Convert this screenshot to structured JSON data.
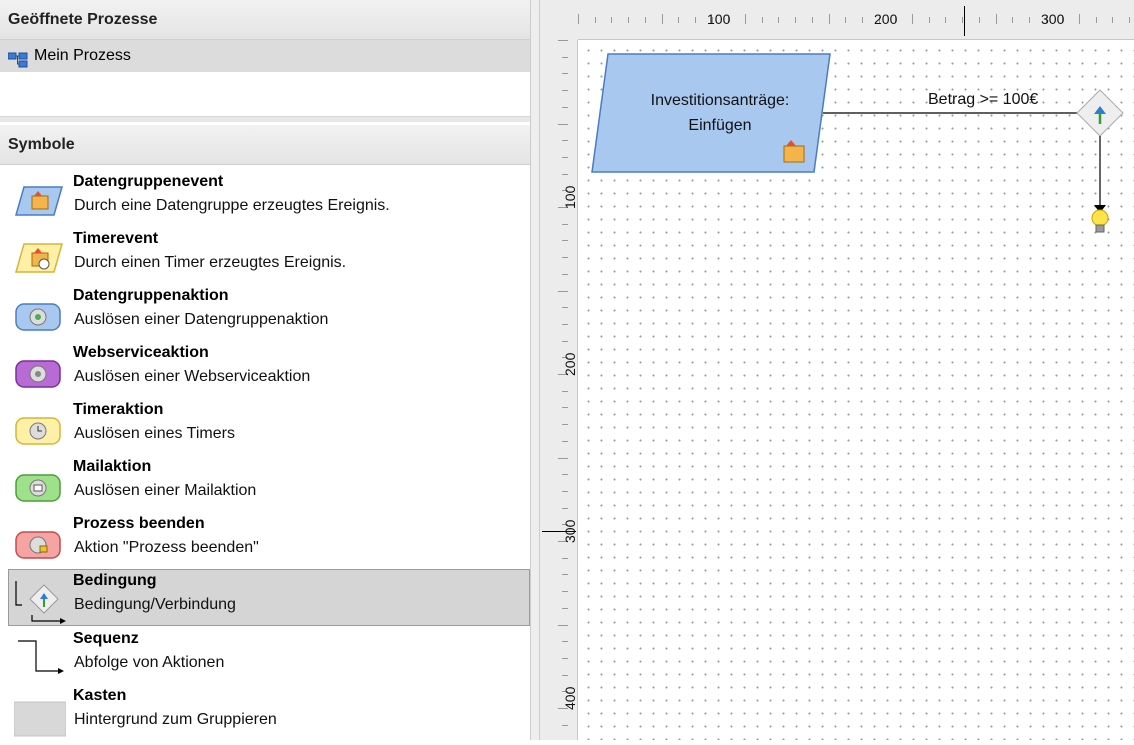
{
  "opened_processes": {
    "header": "Geöffnete Prozesse",
    "items": [
      {
        "label": "Mein Prozess",
        "icon": "process-tree-icon"
      }
    ]
  },
  "symbols": {
    "header": "Symbole",
    "items": [
      {
        "title": "Datengruppenevent",
        "desc": "Durch eine Datengruppe erzeugtes Ereignis.",
        "icon": "datagroup-event-icon"
      },
      {
        "title": "Timerevent",
        "desc": "Durch einen Timer erzeugtes Ereignis.",
        "icon": "timer-event-icon"
      },
      {
        "title": "Datengruppenaktion",
        "desc": "Auslösen einer Datengruppenaktion",
        "icon": "datagroup-action-icon",
        "color": "#a9c8f0"
      },
      {
        "title": "Webserviceaktion",
        "desc": "Auslösen einer Webserviceaktion",
        "icon": "webservice-action-icon",
        "color": "#b86bd4"
      },
      {
        "title": "Timeraktion",
        "desc": "Auslösen eines Timers",
        "icon": "timer-action-icon",
        "color": "#fff0a8"
      },
      {
        "title": "Mailaktion",
        "desc": "Auslösen einer Mailaktion",
        "icon": "mail-action-icon",
        "color": "#9fe08a"
      },
      {
        "title": "Prozess beenden",
        "desc": "Aktion \"Prozess beenden\"",
        "icon": "end-process-icon",
        "color": "#f5a3a3"
      },
      {
        "title": "Bedingung",
        "desc": "Bedingung/Verbindung",
        "icon": "condition-icon",
        "selected": true
      },
      {
        "title": "Sequenz",
        "desc": "Abfolge von Aktionen",
        "icon": "sequence-icon"
      },
      {
        "title": "Kasten",
        "desc": "Hintergrund zum Gruppieren",
        "icon": "box-icon"
      }
    ]
  },
  "ruler": {
    "top_labels": [
      "100",
      "200",
      "300"
    ],
    "left_labels": [
      "100",
      "200",
      "300",
      "400"
    ]
  },
  "canvas": {
    "node": {
      "line1": "Investitionsanträge:",
      "line2": "Einfügen",
      "color": "#a9c8f0"
    },
    "condition_label": "Betrag >= 100€"
  }
}
